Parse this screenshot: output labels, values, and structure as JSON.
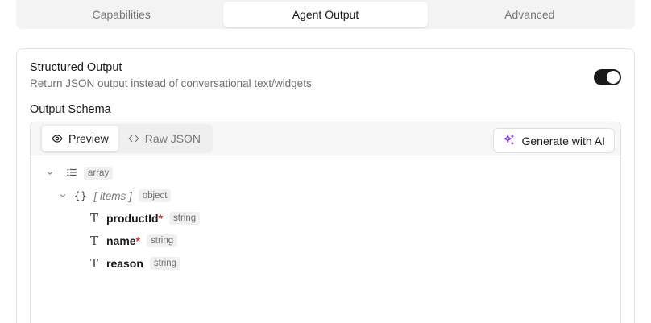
{
  "tabs": [
    {
      "label": "Capabilities",
      "active": false
    },
    {
      "label": "Agent Output",
      "active": true
    },
    {
      "label": "Advanced",
      "active": false
    }
  ],
  "structured_output": {
    "title": "Structured Output",
    "description": "Return JSON output instead of conversational text/widgets",
    "enabled": true
  },
  "output_schema": {
    "label": "Output Schema",
    "view_tabs": [
      {
        "label": "Preview",
        "icon": "eye-icon",
        "active": true
      },
      {
        "label": "Raw JSON",
        "icon": "code-icon",
        "active": false
      }
    ],
    "generate_button": {
      "label": "Generate with AI",
      "icon": "sparkles-icon"
    },
    "tree": {
      "root": {
        "type": "array"
      },
      "items": {
        "label": "[ items ]",
        "type": "object",
        "brace": "{}"
      },
      "fields": [
        {
          "name": "productId",
          "required_mark": "*",
          "type": "string"
        },
        {
          "name": "name",
          "required_mark": "*",
          "type": "string"
        },
        {
          "name": "reason",
          "required_mark": "",
          "type": "string"
        }
      ]
    }
  },
  "colors": {
    "accent_sparkle": "#8b3dff",
    "required": "#d32f2f",
    "toggle_on": "#1a1a1a"
  }
}
